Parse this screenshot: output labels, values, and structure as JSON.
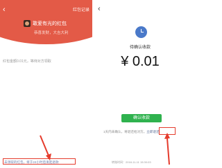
{
  "left_screen": {
    "back_label": "‹",
    "record_label": "红包记录",
    "sender_name": "敢爱有光的红包",
    "greeting": "恭喜发财，大吉大利",
    "status_text": "红包金额0.01元，等待对方领取",
    "bottom_note": "未领取的红包，将于24小时后发起退款"
  },
  "right_screen": {
    "back_label": "‹",
    "pending_label": "待确认收款",
    "amount": "¥ 0.01",
    "confirm_button": "确认收款",
    "note_prefix": "1天内未确认，将退还给对方。",
    "refund_link": "立即退还",
    "time_text": "转账时间：2018-11-11 15:30:03"
  },
  "colors": {
    "header_red": "#e35a47",
    "confirm_green": "#2fb24e",
    "highlight_red": "#e53b2c",
    "clock_blue": "#4a79c9",
    "link_blue": "#576b95"
  },
  "icons": {
    "clock": "clock-icon",
    "back": "back-chevron-icon",
    "avatar": "avatar"
  }
}
